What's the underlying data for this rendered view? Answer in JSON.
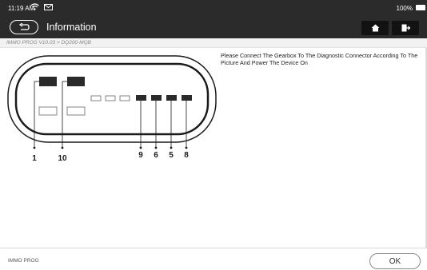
{
  "status_bar": {
    "time": "11:19 AM",
    "battery_percent": "100%",
    "icons": [
      "wifi-icon",
      "message-icon",
      "battery-icon"
    ]
  },
  "header": {
    "title": "Information",
    "buttons": [
      "back-icon",
      "home-icon",
      "exit-icon"
    ]
  },
  "breadcrumb": "IMMO PROG V10.03 > DQ200-MQB",
  "instruction": "Please Connect The Gearbox To The Diagnostic Connector According To The Picture And Power The Device On",
  "diagram": {
    "pin_labels": [
      "1",
      "10",
      "9",
      "6",
      "5",
      "8"
    ]
  },
  "footer": {
    "label": "IMMO PROG",
    "ok_button": "OK"
  },
  "colors": {
    "header_bg": "#2b2b2b",
    "breadcrumb_bg": "#f2f2f2",
    "pin_fill": "#2a2a2a"
  }
}
